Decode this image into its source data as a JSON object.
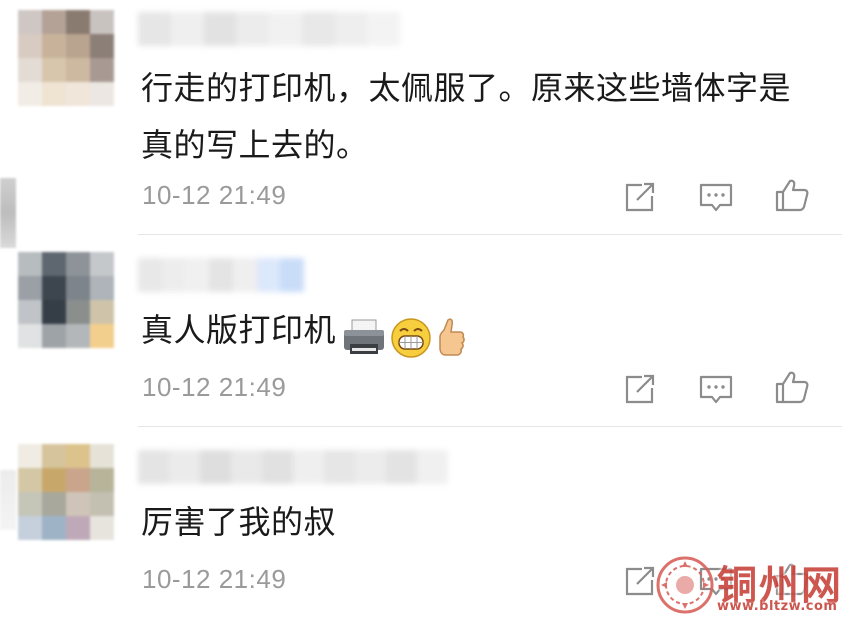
{
  "comments": [
    {
      "text": "行走的打印机，太佩服了。原来这些墙体字是真的写上去的。",
      "timestamp": "10-12 21:49",
      "avatar_colors": [
        "#cfc7c3",
        "#b4a296",
        "#8a7b70",
        "#c9c3c0",
        "#d8cbc2",
        "#c8b39a",
        "#b9a48f",
        "#8c7f78",
        "#e3dcd5",
        "#d7c6ac",
        "#cdb9a0",
        "#a89a92",
        "#f2ece6",
        "#efe3d2",
        "#f1e6da",
        "#ece7e2"
      ],
      "name_blur_colors": [
        "#e6e6e6",
        "#efefef",
        "#e2e2e2",
        "#ececec",
        "#f1f1f1",
        "#e8e8e8",
        "#eeeeee",
        "#f3f3f3"
      ]
    },
    {
      "text": "真人版打印机",
      "emojis": [
        "printer-emoji",
        "grin-emoji",
        "thumbs-up-emoji"
      ],
      "timestamp": "10-12 21:49",
      "avatar_colors": [
        "#b7bcbf",
        "#5e6670",
        "#8d9399",
        "#c4c8cb",
        "#9aa0a6",
        "#3d454f",
        "#7d848b",
        "#aeb4b9",
        "#c0c4c8",
        "#353d47",
        "#8a8f8e",
        "#cfc4a9",
        "#e0e2e3",
        "#9ea3a7",
        "#b3b7b9",
        "#f3cf8d"
      ],
      "name_blur_colors": [
        "#e8e8e8",
        "#ededed",
        "#f0f0f0",
        "#e4e4e4",
        "#efefef",
        "#dce8fb",
        "#c9dcf8"
      ]
    },
    {
      "text": "厉害了我的叔",
      "timestamp": "10-12 21:49",
      "avatar_colors": [
        "#f0ece3",
        "#d6c49c",
        "#dcc38c",
        "#e6e2d8",
        "#d3c7a5",
        "#c8a86a",
        "#caa58c",
        "#b7b49a",
        "#c5c5b8",
        "#a8a89d",
        "#cfc4b8",
        "#c3c0b2",
        "#c5d0dc",
        "#9eb3c6",
        "#bfa9b8",
        "#e7e4dd"
      ],
      "name_blur_colors": [
        "#e4e4e4",
        "#ebebeb",
        "#dedede",
        "#e9e9e9",
        "#e1e1e1",
        "#efefef",
        "#e6e6e6",
        "#ececec",
        "#e3e3e3",
        "#f0f0f0"
      ]
    }
  ],
  "watermark": {
    "text": "铜州网",
    "url": "www.bltzw.com",
    "color": "#c8443c"
  },
  "icons": [
    "share-icon",
    "reply-icon",
    "like-icon"
  ]
}
